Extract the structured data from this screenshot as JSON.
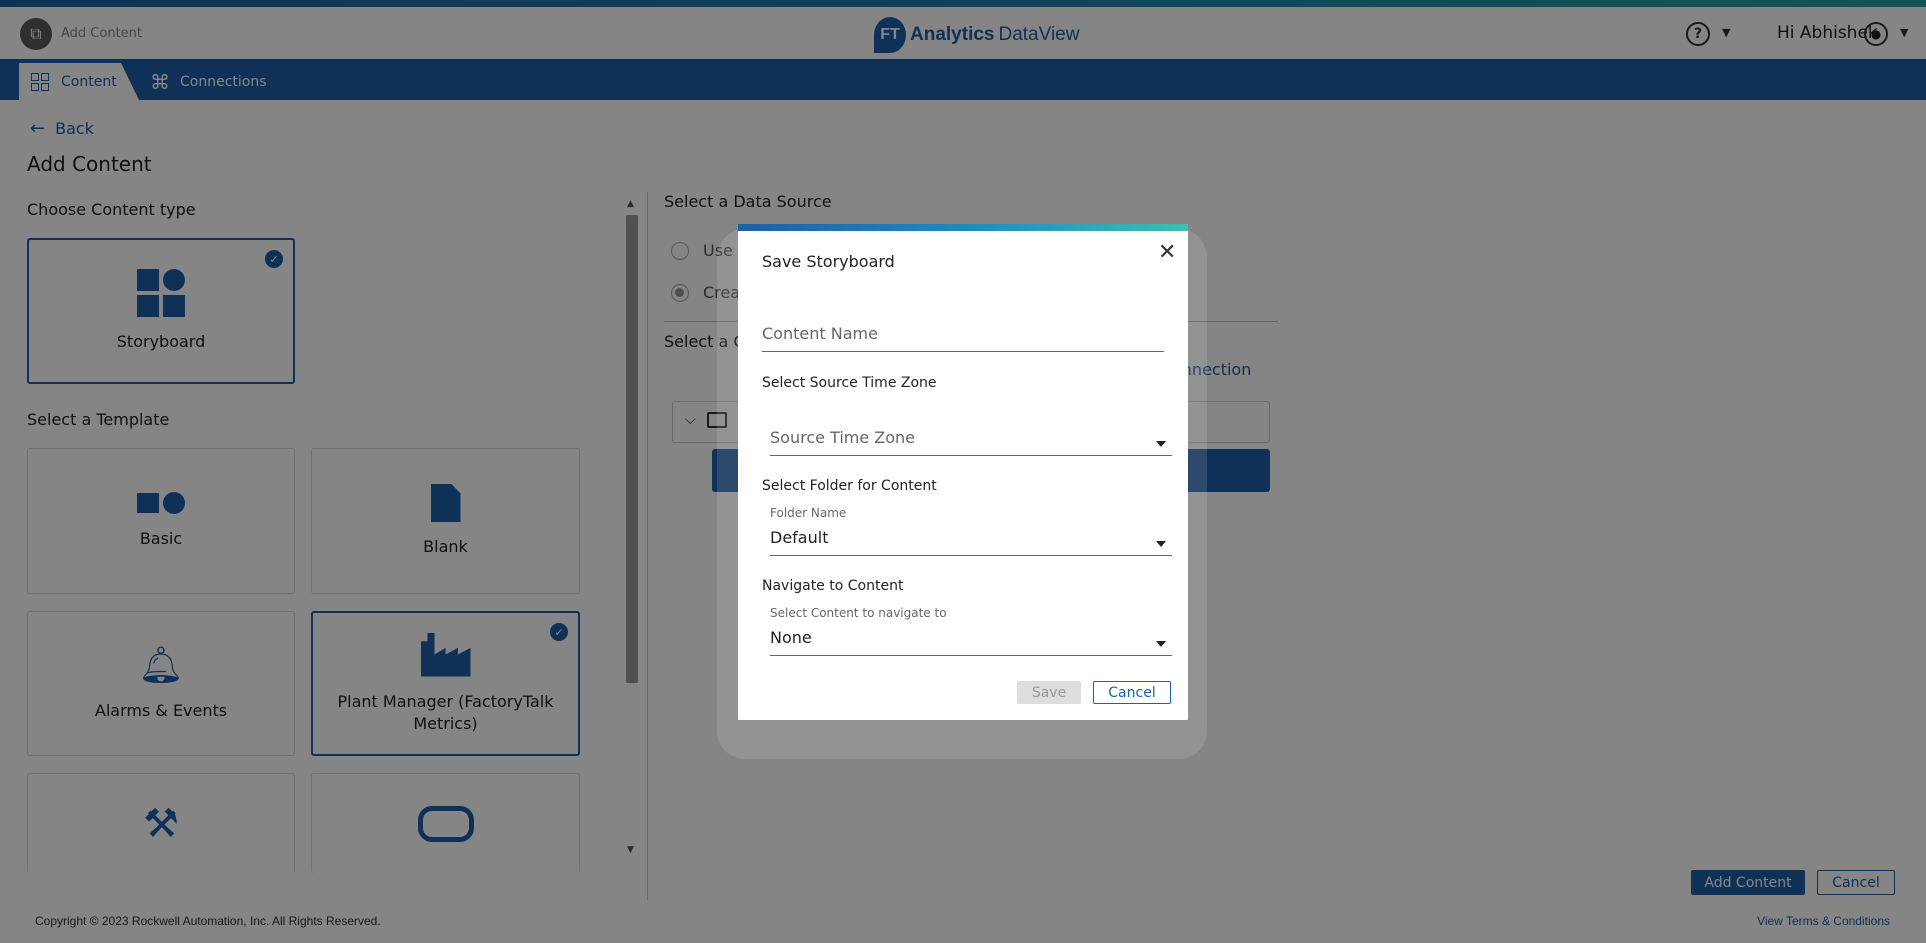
{
  "header": {
    "app_label": "Add Content",
    "logo_badge": "FT",
    "logo_brand": "Analytics",
    "logo_product": "DataView",
    "help_icon": "help-circle-icon",
    "user_greeting": "Hi Abhishek",
    "user_icon": "user-circle-icon"
  },
  "nav": {
    "tabs": [
      {
        "label": "Content",
        "icon": "grid-icon",
        "active": true
      },
      {
        "label": "Connections",
        "icon": "network-icon",
        "active": false
      }
    ]
  },
  "main": {
    "back_label": "Back",
    "title": "Add Content",
    "content_type_label": "Choose Content type",
    "content_types": [
      {
        "title": "Storyboard",
        "selected": true
      }
    ],
    "template_label": "Select a Template",
    "templates": [
      {
        "title": "Basic",
        "selected": false
      },
      {
        "title": "Blank",
        "selected": false
      },
      {
        "title": "Alarms & Events",
        "selected": false
      },
      {
        "title": "Plant Manager (FactoryTalk Metrics)",
        "selected": true
      }
    ],
    "data_source_label": "Select a Data Source",
    "radio_option_1": "Use",
    "radio_option_2": "Crea",
    "connection_section_label": "Select a C",
    "connection_link": "onnection",
    "add_content_button": "Add Content",
    "cancel_button": "Cancel"
  },
  "modal": {
    "title": "Save Storyboard",
    "content_name_placeholder": "Content Name",
    "timezone_group_label": "Select Source Time Zone",
    "timezone_placeholder": "Source Time Zone",
    "folder_group_label": "Select Folder for Content",
    "folder_field_label": "Folder Name",
    "folder_value": "Default",
    "navigate_group_label": "Navigate to Content",
    "navigate_field_label": "Select Content to navigate to",
    "navigate_value": "None",
    "save_button": "Save",
    "cancel_button": "Cancel"
  },
  "footer": {
    "copyright": "Copyright © 2023 Rockwell Automation, Inc. All Rights Reserved.",
    "terms_link": "View Terms & Conditions"
  },
  "colors": {
    "brand": "#1d5fa8",
    "accent_teal": "#2aa39c"
  }
}
